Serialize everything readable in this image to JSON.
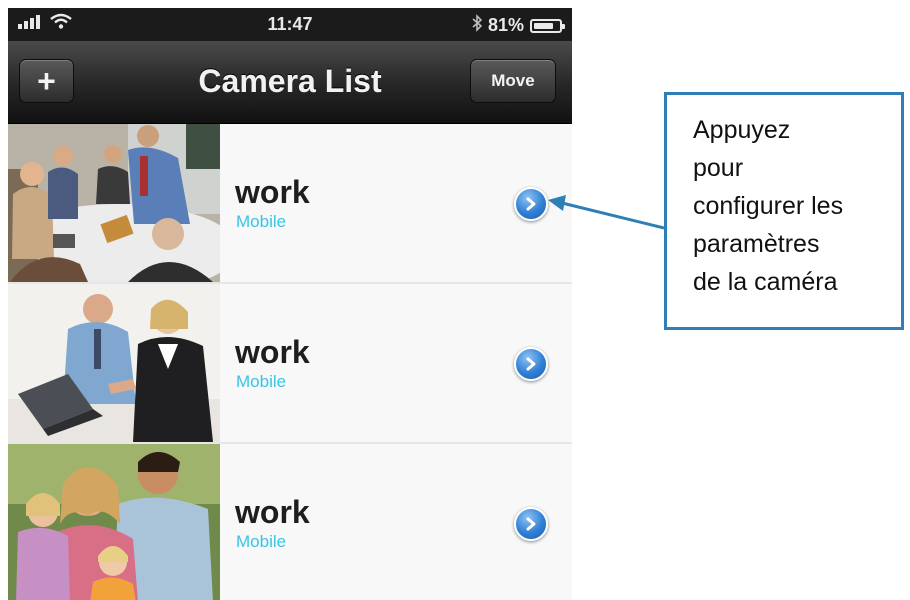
{
  "status_bar": {
    "time": "11:47",
    "battery": "81%",
    "battery_level": 0.81,
    "signal_icon": "signal-bars-icon",
    "wifi_icon": "wifi-icon",
    "bluetooth_icon": "bluetooth-icon"
  },
  "nav": {
    "title": "Camera List",
    "add_label": "+",
    "move_label": "Move"
  },
  "cameras": [
    {
      "name": "work",
      "type": "Mobile",
      "photo": "business-meeting-photo"
    },
    {
      "name": "work",
      "type": "Mobile",
      "photo": "office-colleagues-photo"
    },
    {
      "name": "work",
      "type": "Mobile",
      "photo": "family-photo"
    }
  ],
  "callout": {
    "lines": [
      "Appuyez",
      "pour",
      "configurer les",
      "paramètres",
      "de la caméra"
    ]
  },
  "colors": {
    "subtitle": "#39c4e3",
    "callout_border": "#2f7fb7",
    "disclosure": "#2f7fd4"
  }
}
